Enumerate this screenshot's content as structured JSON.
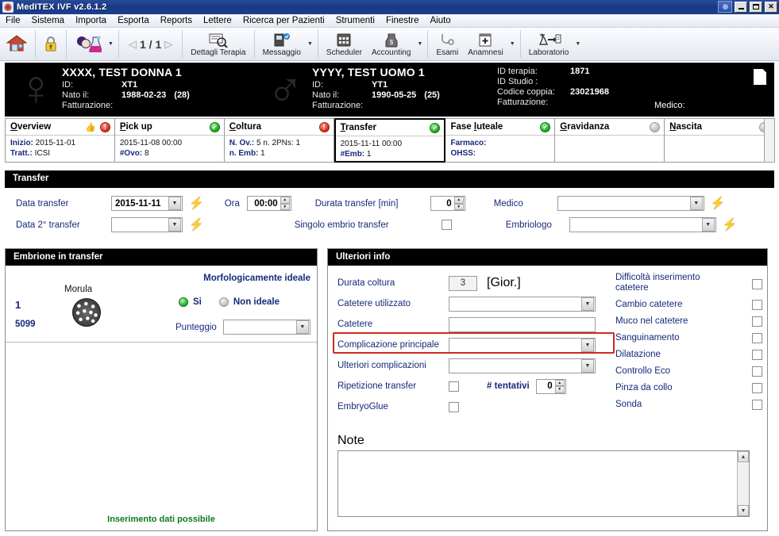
{
  "window": {
    "title": "MedITEX IVF v2.6.1.2",
    "icon": "app-icon",
    "buttons": {
      "minimize": "_",
      "maximize": "□",
      "close": "✕"
    }
  },
  "menubar": {
    "items": [
      "File",
      "Sistema",
      "Importa",
      "Esporta",
      "Reports",
      "Lettere",
      "Ricerca per Pazienti",
      "Strumenti",
      "Finestre",
      "Aiuto"
    ]
  },
  "toolbar": {
    "home": "home-icon",
    "lock": "lock-icon",
    "patients": "patients-icon",
    "pager": {
      "current": "1 / 1",
      "prev": "◁",
      "next": "▷"
    },
    "items": [
      {
        "label": "Dettagli Terapia",
        "icon": "therapy-details-icon",
        "caret": false
      },
      {
        "label": "Messaggio",
        "icon": "message-icon",
        "caret": true
      },
      {
        "label": "Scheduler",
        "icon": "scheduler-icon",
        "caret": false
      },
      {
        "label": "Accounting",
        "icon": "accounting-icon",
        "caret": true
      },
      {
        "label": "Esami",
        "icon": "exams-icon",
        "caret": false
      },
      {
        "label": "Anamnesi",
        "icon": "anamnesis-icon",
        "caret": true
      },
      {
        "label": "Laboratorio",
        "icon": "laboratory-icon",
        "caret": true
      }
    ]
  },
  "banner": {
    "female": {
      "name": "XXXX, TEST DONNA 1",
      "id_label": "ID:",
      "id_value": "XT1",
      "dob_label": "Nato il:",
      "dob_value": "1988-02-23",
      "age": "(28)",
      "billing_label": "Fatturazione:",
      "billing_value": ""
    },
    "male": {
      "name": "YYYY, TEST UOMO 1",
      "id_label": "ID:",
      "id_value": "YT1",
      "dob_label": "Nato il:",
      "dob_value": "1990-05-25",
      "age": "(25)",
      "billing_label": "Fatturazione:",
      "billing_value": ""
    },
    "therapy": {
      "id_terapia_label": "ID terapia:",
      "id_terapia_value": "1871",
      "id_studio_label": "ID Studio :",
      "id_studio_value": "",
      "codice_coppia_label": "Codice coppia:",
      "codice_coppia_value": "23021968",
      "fatturazione_label": "Fatturazione:",
      "fatturazione_value": "",
      "medico_label": "Medico:"
    }
  },
  "tabs": [
    {
      "title": "Overview",
      "accel": "O",
      "status": "red",
      "thumb": true,
      "lines": [
        {
          "k": "Inizio:",
          "v": "2015-11-01"
        },
        {
          "k": "Tratt.:",
          "v": "ICSI"
        }
      ],
      "selected": false
    },
    {
      "title": "Pick up",
      "accel": "P",
      "status": "green",
      "thumb": false,
      "lines": [
        {
          "k": "",
          "v": "2015-11-08 00:00"
        },
        {
          "k": "#Ovo:",
          "v": "8"
        }
      ],
      "selected": false
    },
    {
      "title": "Coltura",
      "accel": "C",
      "status": "red",
      "thumb": false,
      "lines": [
        {
          "k": "N. Ov.:",
          "v": "5 n. 2PNs: 1"
        },
        {
          "k": "n. Emb:",
          "v": "1"
        }
      ],
      "selected": false
    },
    {
      "title": "Transfer",
      "accel": "T",
      "status": "green",
      "thumb": false,
      "lines": [
        {
          "k": "",
          "v": "2015-11-11 00:00"
        },
        {
          "k": "#Emb:",
          "v": "1"
        }
      ],
      "selected": true
    },
    {
      "title": "Fase luteale",
      "accel": "l",
      "status": "green",
      "thumb": false,
      "lines": [
        {
          "k": "Farmaco:",
          "v": ""
        },
        {
          "k": "OHSS:",
          "v": ""
        }
      ],
      "selected": false
    },
    {
      "title": "Gravidanza",
      "accel": "G",
      "status": "grey",
      "thumb": false,
      "lines": [
        {
          "k": "",
          "v": ""
        },
        {
          "k": "",
          "v": ""
        }
      ],
      "selected": false
    },
    {
      "title": "Nascita",
      "accel": "N",
      "status": "grey",
      "thumb": false,
      "lines": [
        {
          "k": "",
          "v": ""
        },
        {
          "k": "",
          "v": ""
        }
      ],
      "selected": false
    }
  ],
  "transfer": {
    "section_title": "Transfer",
    "data_transfer_label": "Data transfer",
    "data_transfer_value": "2015-11-11",
    "data_2_transfer_label": "Data 2° transfer",
    "data_2_transfer_value": "",
    "ora_label": "Ora",
    "ora_value": "00:00",
    "durata_label": "Durata transfer [min]",
    "durata_value": "0",
    "singolo_label": "Singolo embrio transfer",
    "singolo_checked": false,
    "medico_label": "Medico",
    "medico_value": "",
    "embriologo_label": "Embriologo",
    "embriologo_value": ""
  },
  "embryo_panel": {
    "title": "Embrione in transfer",
    "morfologia_label": "Morfologicamente ideale",
    "number": "1",
    "code": "5099",
    "stage": "Morula",
    "stage_icon": "morula-icon",
    "si_label": "Si",
    "non_ideale_label": "Non ideale",
    "punteggio_label": "Punteggio",
    "punteggio_value": "",
    "status_text": "Inserimento dati possibile"
  },
  "ulteriori": {
    "title": "Ulteriori info",
    "durata_coltura_label": "Durata coltura",
    "durata_coltura_value": "3",
    "durata_coltura_unit": "[Gior.]",
    "catetere_utilizzato_label": "Catetere utilizzato",
    "catetere_utilizzato_value": "",
    "catetere_label": "Catetere",
    "catetere_value": "",
    "complicazione_label": "Complicazione principale",
    "complicazione_value": "",
    "complicazione_highlight_color": "#cc2a22",
    "ulteriori_complicazioni_label": "Ulteriori complicazioni",
    "ulteriori_complicazioni_value": "",
    "ripetizione_label": "Ripetizione transfer",
    "ripetizione_checked": false,
    "tentativi_label": "# tentativi",
    "tentativi_value": "0",
    "embryoglue_label": "EmbryoGlue",
    "embryoglue_checked": false,
    "note_label": "Note",
    "note_value": "",
    "checkboxes": [
      {
        "label": "Difficoltà inserimento catetere",
        "checked": false
      },
      {
        "label": "Cambio catetere",
        "checked": false
      },
      {
        "label": "Muco nel catetere",
        "checked": false
      },
      {
        "label": "Sanguinamento",
        "checked": false
      },
      {
        "label": "Dilatazione",
        "checked": false
      },
      {
        "label": "Controllo Eco",
        "checked": false
      },
      {
        "label": "Pinza da collo",
        "checked": false
      },
      {
        "label": "Sonda",
        "checked": false
      }
    ]
  }
}
